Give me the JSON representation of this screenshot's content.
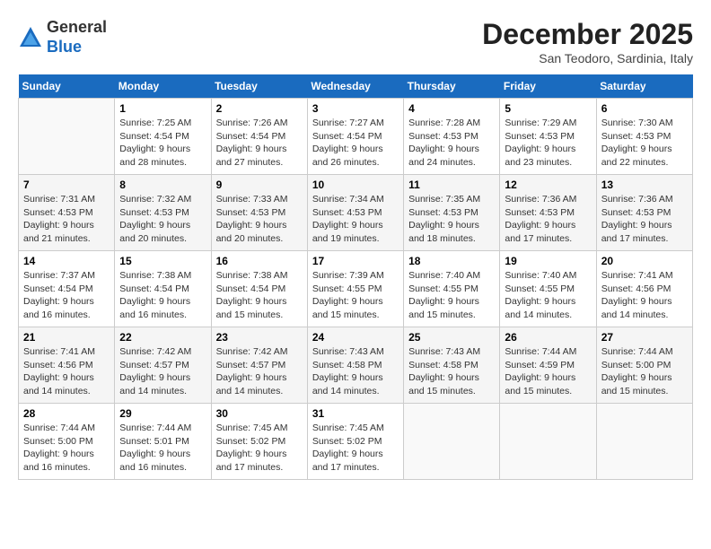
{
  "header": {
    "logo_general": "General",
    "logo_blue": "Blue",
    "month_title": "December 2025",
    "subtitle": "San Teodoro, Sardinia, Italy"
  },
  "days_of_week": [
    "Sunday",
    "Monday",
    "Tuesday",
    "Wednesday",
    "Thursday",
    "Friday",
    "Saturday"
  ],
  "weeks": [
    [
      {
        "day": "",
        "info": ""
      },
      {
        "day": "1",
        "info": "Sunrise: 7:25 AM\nSunset: 4:54 PM\nDaylight: 9 hours\nand 28 minutes."
      },
      {
        "day": "2",
        "info": "Sunrise: 7:26 AM\nSunset: 4:54 PM\nDaylight: 9 hours\nand 27 minutes."
      },
      {
        "day": "3",
        "info": "Sunrise: 7:27 AM\nSunset: 4:54 PM\nDaylight: 9 hours\nand 26 minutes."
      },
      {
        "day": "4",
        "info": "Sunrise: 7:28 AM\nSunset: 4:53 PM\nDaylight: 9 hours\nand 24 minutes."
      },
      {
        "day": "5",
        "info": "Sunrise: 7:29 AM\nSunset: 4:53 PM\nDaylight: 9 hours\nand 23 minutes."
      },
      {
        "day": "6",
        "info": "Sunrise: 7:30 AM\nSunset: 4:53 PM\nDaylight: 9 hours\nand 22 minutes."
      }
    ],
    [
      {
        "day": "7",
        "info": "Sunrise: 7:31 AM\nSunset: 4:53 PM\nDaylight: 9 hours\nand 21 minutes."
      },
      {
        "day": "8",
        "info": "Sunrise: 7:32 AM\nSunset: 4:53 PM\nDaylight: 9 hours\nand 20 minutes."
      },
      {
        "day": "9",
        "info": "Sunrise: 7:33 AM\nSunset: 4:53 PM\nDaylight: 9 hours\nand 20 minutes."
      },
      {
        "day": "10",
        "info": "Sunrise: 7:34 AM\nSunset: 4:53 PM\nDaylight: 9 hours\nand 19 minutes."
      },
      {
        "day": "11",
        "info": "Sunrise: 7:35 AM\nSunset: 4:53 PM\nDaylight: 9 hours\nand 18 minutes."
      },
      {
        "day": "12",
        "info": "Sunrise: 7:36 AM\nSunset: 4:53 PM\nDaylight: 9 hours\nand 17 minutes."
      },
      {
        "day": "13",
        "info": "Sunrise: 7:36 AM\nSunset: 4:53 PM\nDaylight: 9 hours\nand 17 minutes."
      }
    ],
    [
      {
        "day": "14",
        "info": "Sunrise: 7:37 AM\nSunset: 4:54 PM\nDaylight: 9 hours\nand 16 minutes."
      },
      {
        "day": "15",
        "info": "Sunrise: 7:38 AM\nSunset: 4:54 PM\nDaylight: 9 hours\nand 16 minutes."
      },
      {
        "day": "16",
        "info": "Sunrise: 7:38 AM\nSunset: 4:54 PM\nDaylight: 9 hours\nand 15 minutes."
      },
      {
        "day": "17",
        "info": "Sunrise: 7:39 AM\nSunset: 4:55 PM\nDaylight: 9 hours\nand 15 minutes."
      },
      {
        "day": "18",
        "info": "Sunrise: 7:40 AM\nSunset: 4:55 PM\nDaylight: 9 hours\nand 15 minutes."
      },
      {
        "day": "19",
        "info": "Sunrise: 7:40 AM\nSunset: 4:55 PM\nDaylight: 9 hours\nand 14 minutes."
      },
      {
        "day": "20",
        "info": "Sunrise: 7:41 AM\nSunset: 4:56 PM\nDaylight: 9 hours\nand 14 minutes."
      }
    ],
    [
      {
        "day": "21",
        "info": "Sunrise: 7:41 AM\nSunset: 4:56 PM\nDaylight: 9 hours\nand 14 minutes."
      },
      {
        "day": "22",
        "info": "Sunrise: 7:42 AM\nSunset: 4:57 PM\nDaylight: 9 hours\nand 14 minutes."
      },
      {
        "day": "23",
        "info": "Sunrise: 7:42 AM\nSunset: 4:57 PM\nDaylight: 9 hours\nand 14 minutes."
      },
      {
        "day": "24",
        "info": "Sunrise: 7:43 AM\nSunset: 4:58 PM\nDaylight: 9 hours\nand 14 minutes."
      },
      {
        "day": "25",
        "info": "Sunrise: 7:43 AM\nSunset: 4:58 PM\nDaylight: 9 hours\nand 15 minutes."
      },
      {
        "day": "26",
        "info": "Sunrise: 7:44 AM\nSunset: 4:59 PM\nDaylight: 9 hours\nand 15 minutes."
      },
      {
        "day": "27",
        "info": "Sunrise: 7:44 AM\nSunset: 5:00 PM\nDaylight: 9 hours\nand 15 minutes."
      }
    ],
    [
      {
        "day": "28",
        "info": "Sunrise: 7:44 AM\nSunset: 5:00 PM\nDaylight: 9 hours\nand 16 minutes."
      },
      {
        "day": "29",
        "info": "Sunrise: 7:44 AM\nSunset: 5:01 PM\nDaylight: 9 hours\nand 16 minutes."
      },
      {
        "day": "30",
        "info": "Sunrise: 7:45 AM\nSunset: 5:02 PM\nDaylight: 9 hours\nand 17 minutes."
      },
      {
        "day": "31",
        "info": "Sunrise: 7:45 AM\nSunset: 5:02 PM\nDaylight: 9 hours\nand 17 minutes."
      },
      {
        "day": "",
        "info": ""
      },
      {
        "day": "",
        "info": ""
      },
      {
        "day": "",
        "info": ""
      }
    ]
  ]
}
